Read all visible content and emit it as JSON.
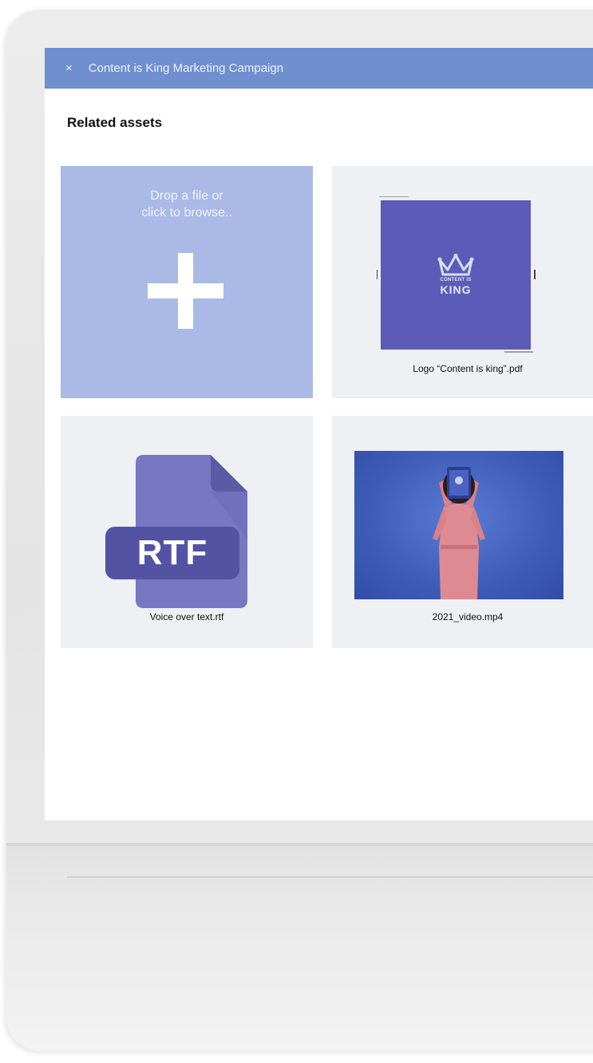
{
  "header": {
    "close_icon": "×",
    "title": "Content is King Marketing Campaign"
  },
  "section": {
    "title": "Related assets"
  },
  "dropzone": {
    "line1": "Drop a file or",
    "line2": "click to browse.."
  },
  "assets": [
    {
      "name": "Logo “Content is king”.pdf",
      "type": "pdf",
      "logo_small": "CONTENT IS",
      "logo_big": "KING"
    },
    {
      "name": "Voice over text.rtf",
      "type": "rtf",
      "badge": "RTF"
    },
    {
      "name": "2021_video.mp4",
      "type": "video"
    }
  ],
  "colors": {
    "header_bg": "#6f8fcf",
    "dropzone_bg": "#aab9e6",
    "tile_bg": "#eef0f3",
    "logo_bg": "#5c5cb8",
    "rtf_icon": "#7877c2",
    "video_bg": "#3f5db8"
  }
}
